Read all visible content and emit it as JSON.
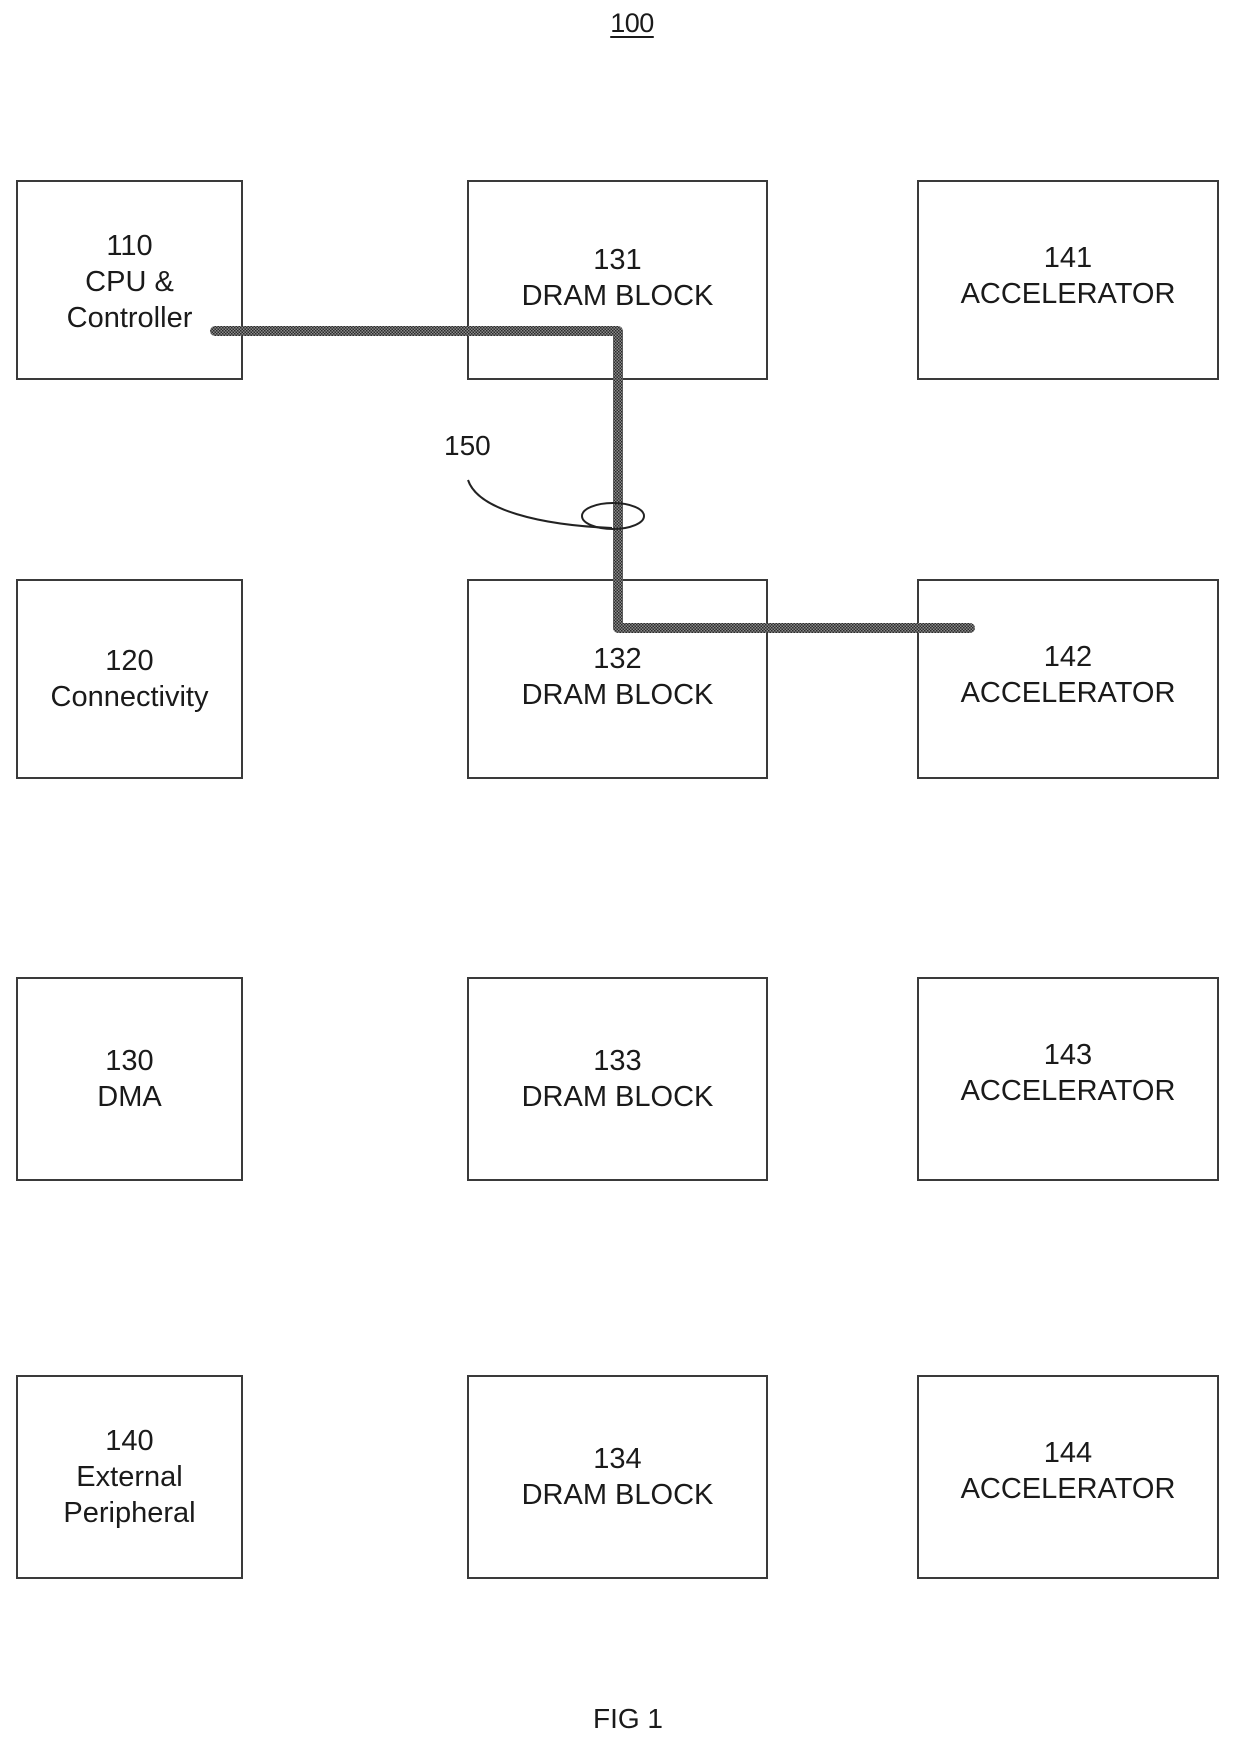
{
  "figure": {
    "reference": "100",
    "caption": "FIG 1"
  },
  "blocks": {
    "cpu": {
      "number": "110",
      "lines": [
        "CPU &",
        "Controller"
      ]
    },
    "connectivity": {
      "number": "120",
      "lines": [
        "Connectivity"
      ]
    },
    "dma": {
      "number": "130",
      "lines": [
        "DMA"
      ]
    },
    "peripheral": {
      "number": "140",
      "lines": [
        "External",
        "Peripheral"
      ]
    },
    "dram131": {
      "number": "131",
      "lines": [
        "DRAM BLOCK"
      ]
    },
    "dram132": {
      "number": "132",
      "lines": [
        "DRAM BLOCK"
      ]
    },
    "dram133": {
      "number": "133",
      "lines": [
        "DRAM BLOCK"
      ]
    },
    "dram134": {
      "number": "134",
      "lines": [
        "DRAM BLOCK"
      ]
    },
    "acc141": {
      "number": "141",
      "lines": [
        "ACCELERATOR"
      ]
    },
    "acc142": {
      "number": "142",
      "lines": [
        "ACCELERATOR"
      ]
    },
    "acc143": {
      "number": "143",
      "lines": [
        "ACCELERATOR"
      ]
    },
    "acc144": {
      "number": "144",
      "lines": [
        "ACCELERATOR"
      ]
    }
  },
  "connection": {
    "reference": "150",
    "from": "110 CPU & Controller",
    "via": "131 DRAM BLOCK / 132 DRAM BLOCK",
    "to": "142 ACCELERATOR"
  },
  "colors": {
    "line": "#3a3a3a",
    "wire": "#555555"
  }
}
